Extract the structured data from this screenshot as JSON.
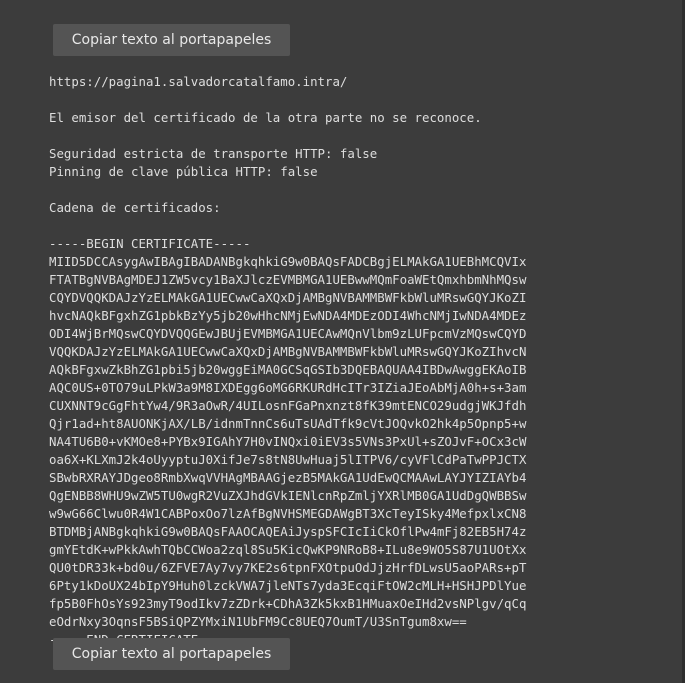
{
  "buttons": {
    "copy_label": "Copiar texto al portapapeles"
  },
  "url": "https://pagina1.salvadorcatalfamo.intra/",
  "message": "El emisor del certificado de la otra parte no se reconoce.",
  "hsts": "Seguridad estricta de transporte HTTP: false",
  "hpkp": "Pinning de clave pública HTTP: false",
  "chain_title": "Cadena de certificados:",
  "certificate": {
    "begin": "-----BEGIN CERTIFICATE-----",
    "lines": [
      "MIID5DCCAsygAwIBAgIBADANBgkqhkiG9w0BAQsFADCBgjELMAkGA1UEBhMCQVIx",
      "FTATBgNVBAgMDEJ1ZW5vcy1BaXJlczEVMBMGA1UEBwwMQmFoaWEtQmxhbmNhMQsw",
      "CQYDVQQKDAJzYzELMAkGA1UECwwCaXQxDjAMBgNVBAMMBWFkbWluMRswGQYJKoZI",
      "hvcNAQkBFgxhZG1pbkBzYy5jb20wHhcNMjEwNDA4MDEzODI4WhcNMjIwNDA4MDEz",
      "ODI4WjBrMQswCQYDVQQGEwJBUjEVMBMGA1UECAwMQnVlbm9zLUFpcmVzMQswCQYD",
      "VQQKDAJzYzELMAkGA1UECwwCaXQxDjAMBgNVBAMMBWFkbWluMRswGQYJKoZIhvcN",
      "AQkBFgxwZkBhZG1pbi5jb20wggEiMA0GCSqGSIb3DQEBAQUAA4IBDwAwggEKAoIB",
      "AQC0US+0TO79uLPkW3a9M8IXDEgg6oMG6RKURdHcITr3IZiaJEoAbMjA0h+s+3am",
      "CUXNNT9cGgFhtYw4/9R3aOwR/4UILosnFGaPnxnzt8fK39mtENCO29udgjWKJfdh",
      "Qjr1ad+ht8AUONKjAX/LB/idnmTnnCs6uTsUAdTfk9cVtJOQvkO2hk4p5Opnp5+w",
      "NA4TU6B0+vKMOe8+PYBx9IGAhY7H0vINQxi0iEV3s5VNs3PxUl+sZOJvF+OCx3cW",
      "oa6X+KLXmJ2k4oUyyptuJ0XifJe7s8tN8UwHuaj5lITPV6/cyVFlCdPaTwPPJCTX",
      "SBwbRXRAYJDgeo8RmbXwqVVHAgMBAAGjezB5MAkGA1UdEwQCMAAwLAYJYIZIAYb4",
      "QgENBB8WHU9wZW5TU0wgR2VuZXJhdGVkIENlcnRpZmljYXRlMB0GA1UdDgQWBBSw",
      "w9wG66Clwu0R4W1CABPoxOo7lzAfBgNVHSMEGDAWgBT3XcTeyISky4MefpxlxCN8",
      "BTDMBjANBgkqhkiG9w0BAQsFAAOCAQEAiJyspSFCIcIiCkOflPw4mFj82EB5H74z",
      "gmYEtdK+wPkkAwhTQbCCWoa2zql8Su5KicQwKP9NRoB8+ILu8e9WO5S87U1UOtXx",
      "QU0tDR33k+bd0u/6ZFVE7Ay7vy7KE2s6tpnFXOtpuOdJjzHrfDLwsU5aoPARs+pT",
      "6Pty1kDoUX24bIpY9Huh0lzckVWA7jleNTs7yda3EcqiFtOW2cMLH+HSHJPDlYue",
      "fp5B0FhOsYs923myT9odIkv7zZDrk+CDhA3Zk5kxB1HMuaxOeIHd2vsNPlgv/qCq",
      "eOdrNxy3OqnsF5BSiQPZYMxiN1UbFM9Cc8UEQ7OumT/U3SnTgum8xw=="
    ],
    "end": "-----END CERTIFICATE-----"
  }
}
